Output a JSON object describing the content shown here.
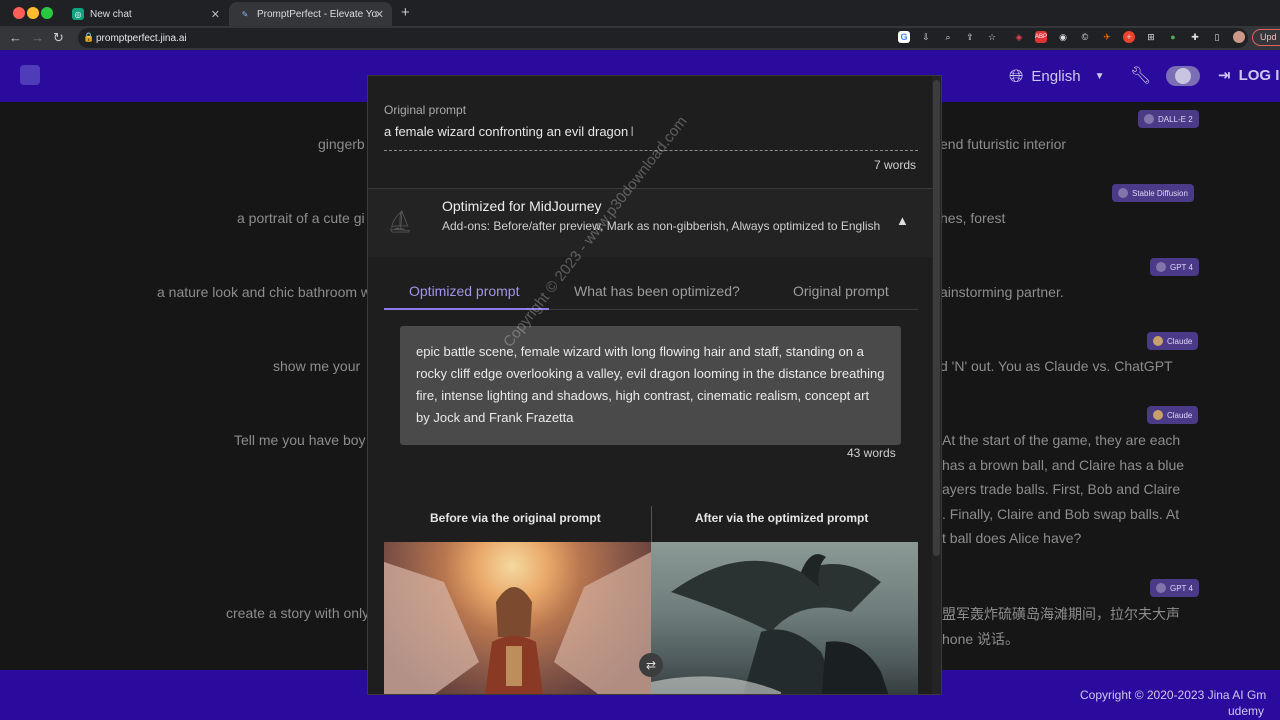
{
  "browser": {
    "tabs": [
      {
        "label": "New chat"
      },
      {
        "label": "PromptPerfect - Elevate Your P"
      }
    ],
    "url": "promptperfect.jina.ai",
    "update_label": "Upd"
  },
  "header": {
    "language": "English",
    "login": "LOG I"
  },
  "background": {
    "rows_left": [
      "gingerb",
      "a portrait of a cute gi",
      "a nature look and chic bathroom w",
      "show me your",
      "Tell me you have boy",
      "create a story with only"
    ],
    "rows_right": [
      "end futuristic interior",
      "hes, forest",
      "ainstorming partner.",
      "d 'N' out. You as Claude vs. ChatGPT",
      "At the start of the game, they are each",
      "has a brown ball, and Claire has a blue",
      "ayers trade balls. First, Bob and Claire",
      ". Finally, Claire and Bob swap balls. At",
      "t ball does Alice have?",
      "盟军轰炸硫磺岛海滩期间，拉尔夫大声",
      "hone 说话。"
    ],
    "badges": [
      "DALL-E 2",
      "Stable Diffusion",
      "GPT 4",
      "Claude",
      "Claude",
      "GPT 4"
    ],
    "footer_copyright": "Copyright © 2020-2023 Jina AI Gm",
    "footer_udemy": "udemy"
  },
  "modal": {
    "original_label": "Original prompt",
    "original_value": "a female wizard confronting an evil dragon",
    "original_word_count": "7 words",
    "optimized_title": "Optimized for MidJourney",
    "addons": "Add-ons: Before/after preview, Mark as non-gibberish, Always optimized to English",
    "tabs": [
      "Optimized prompt",
      "What has been optimized?",
      "Original prompt"
    ],
    "optimized_text": "epic battle scene, female wizard with long flowing hair and staff, standing on a rocky cliff edge overlooking a valley, evil dragon looming in the distance breathing fire, intense lighting and shadows, high contrast, cinematic realism, concept art by Jock and Frank Frazetta",
    "optimized_word_count": "43 words",
    "before_label": "Before via the original prompt",
    "after_label": "After via the optimized prompt"
  },
  "watermark": "Copyright © 2023 - www.p30download.com"
}
